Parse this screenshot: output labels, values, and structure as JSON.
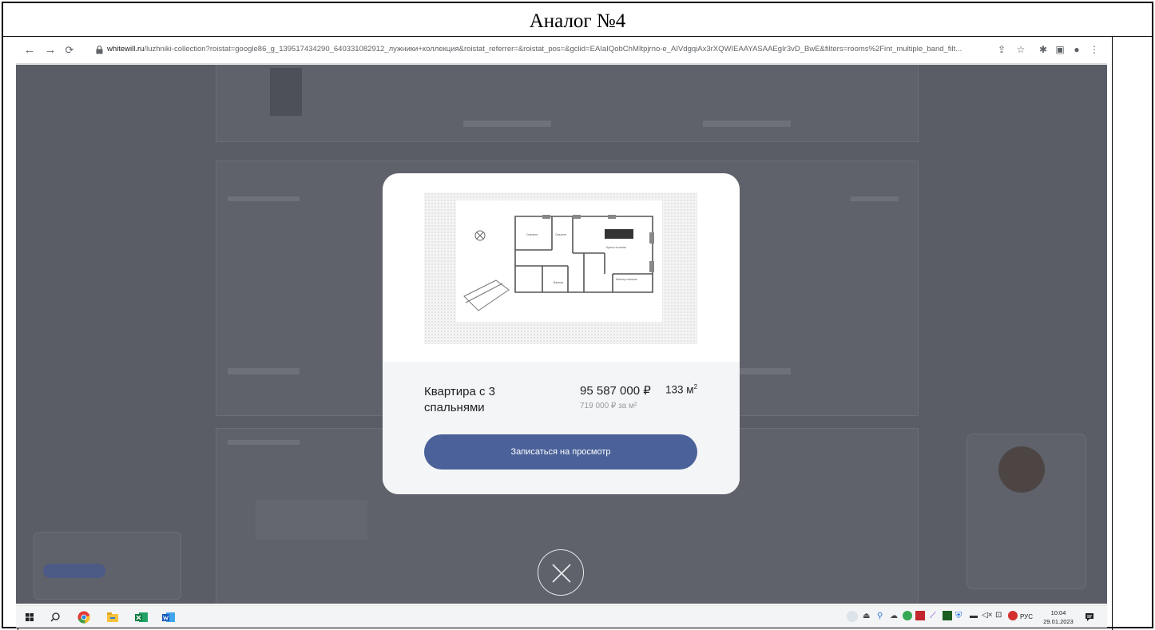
{
  "document": {
    "title": "Аналог №4"
  },
  "browser": {
    "url_host": "whitewill.ru",
    "url_rest": "/luzhniki-collection?roistat=google86_g_139517434290_640331082912_лужники+коллекция&roistat_referrer=&roistat_pos=&gclid=EAIaIQobChMItpjrno-e_AIVdgqiAx3rXQWIEAAYASAAEgIr3vD_BwE&filters=rooms%2Fint_multiple_band_filt..."
  },
  "modal": {
    "flat_title": "Квартира с 3 спальнями",
    "price": "95 587 000 ₽",
    "area_value": "133 м",
    "area_sup": "2",
    "price_per_m2": "719 000 ₽ за м²",
    "book_button": "Записаться на просмотр"
  },
  "taskbar": {
    "language": "РУС",
    "time": "10:04",
    "date": "29.01.2023"
  },
  "colors": {
    "accent": "#4a6199",
    "overlay": "#5a5d65"
  }
}
